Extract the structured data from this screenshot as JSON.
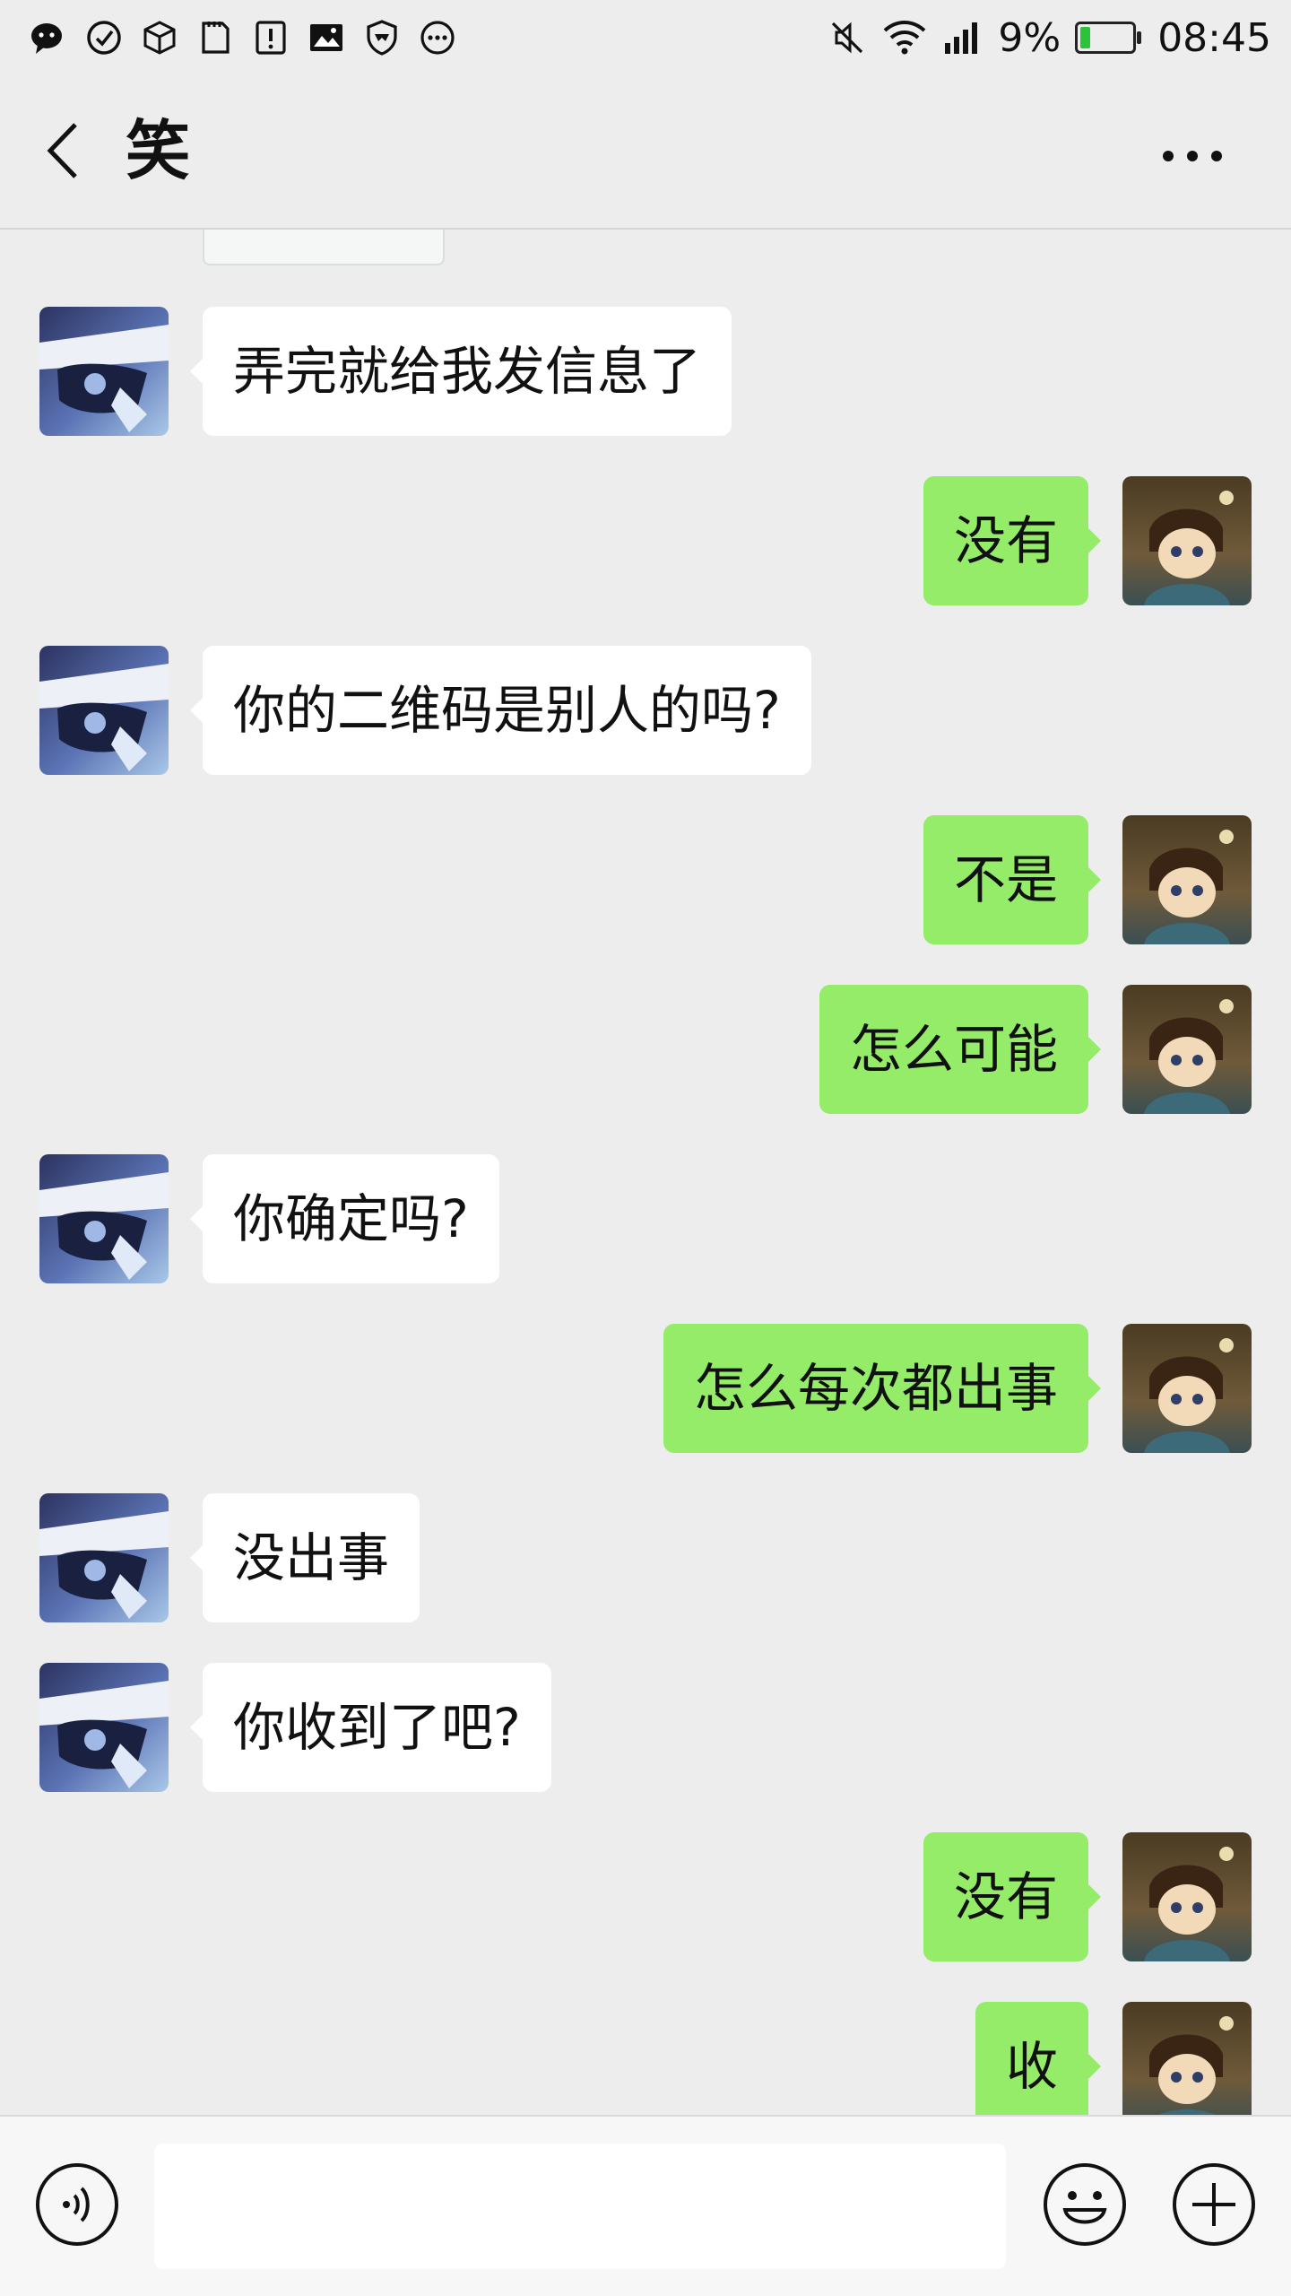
{
  "status_bar": {
    "battery_percent": "9%",
    "battery_level": 0.09,
    "battery_color": "#2ac33a",
    "time": "08:45",
    "left_icons": [
      "wechat-icon",
      "check-circle-icon",
      "box-icon",
      "sim-card-icon",
      "alert-card-icon",
      "image-icon",
      "shield-icon",
      "more-circle-icon"
    ],
    "right_icons": [
      "mute-icon",
      "wifi-icon",
      "signal-icon",
      "battery-icon"
    ]
  },
  "header": {
    "title": "笑"
  },
  "colors": {
    "background": "#ededed",
    "incoming_bubble": "#ffffff",
    "outgoing_bubble": "#95ec69"
  },
  "messages": [
    {
      "side": "in",
      "text": "弄完就给我发信息了"
    },
    {
      "side": "out",
      "text": "没有"
    },
    {
      "side": "in",
      "text": "你的二维码是别人的吗?"
    },
    {
      "side": "out",
      "text": "不是"
    },
    {
      "side": "out",
      "text": "怎么可能"
    },
    {
      "side": "in",
      "text": "你确定吗?"
    },
    {
      "side": "out",
      "text": "怎么每次都出事"
    },
    {
      "side": "in",
      "text": "没出事"
    },
    {
      "side": "in",
      "text": "你收到了吧?"
    },
    {
      "side": "out",
      "text": "没有"
    },
    {
      "side": "out",
      "text": "收"
    }
  ],
  "input_bar": {
    "text_value": "",
    "icons": [
      "voice-icon",
      "emoji-icon",
      "plus-icon"
    ]
  }
}
